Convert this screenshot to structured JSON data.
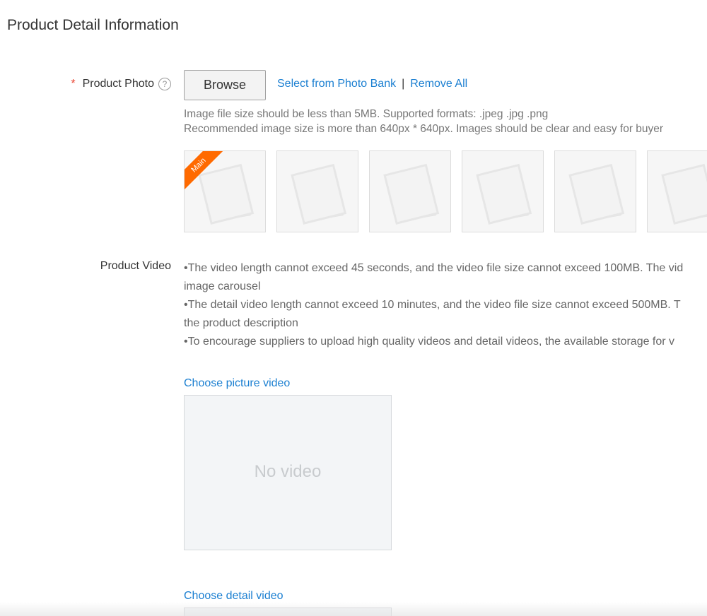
{
  "section": {
    "title": "Product Detail Information"
  },
  "product_photo": {
    "required_mark": "*",
    "label": "Product Photo",
    "help_glyph": "?",
    "browse_label": "Browse",
    "select_from_bank_label": "Select from Photo Bank",
    "separator": "|",
    "remove_all_label": "Remove All",
    "hint_line_1": "Image file size should be less than 5MB. Supported formats: .jpeg .jpg .png",
    "hint_line_2": "Recommended image size is more than 640px * 640px. Images should be clear and easy for buyer",
    "main_badge": "Main",
    "thumb_icon": "image-placeholder-icon",
    "ribbon_color": "#ff6a00"
  },
  "product_video": {
    "label": "Product Video",
    "notes": [
      "•The video length cannot exceed 45 seconds, and the video file size cannot exceed 100MB. The vid",
      "image carousel",
      "•The detail video length cannot exceed 10 minutes, and the video file size cannot exceed 500MB. T",
      "the product description",
      "•To encourage suppliers to upload high quality videos and detail videos, the available storage for v"
    ],
    "choose_picture_label": "Choose picture video",
    "picture_video_empty_text": "No video",
    "choose_detail_label": "Choose detail video"
  },
  "colors": {
    "link": "#1b7fd1",
    "required": "#e8402d",
    "hint": "#777777"
  }
}
